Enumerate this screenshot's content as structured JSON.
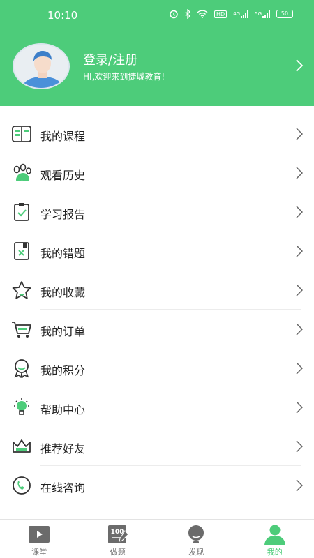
{
  "status_bar": {
    "time": "10:10",
    "network_1": "4G",
    "network_2": "5G",
    "hd": "HD",
    "battery": "50"
  },
  "colors": {
    "brand_green": "#4dcc7a",
    "tab_inactive": "#777777"
  },
  "header": {
    "login_label": "登录/注册",
    "welcome_text": "HI,欢迎来到捷城教育!"
  },
  "menu": {
    "items": [
      {
        "label": "我的课程",
        "icon": "course-book-icon"
      },
      {
        "label": "观看历史",
        "icon": "paw-history-icon"
      },
      {
        "label": "学习报告",
        "icon": "clipboard-check-icon"
      },
      {
        "label": "我的错题",
        "icon": "wrong-question-icon"
      },
      {
        "label": "我的收藏",
        "icon": "star-icon"
      },
      {
        "label": "我的订单",
        "icon": "cart-icon"
      },
      {
        "label": "我的积分",
        "icon": "badge-award-icon"
      },
      {
        "label": "帮助中心",
        "icon": "lightbulb-icon"
      },
      {
        "label": "推荐好友",
        "icon": "crown-icon"
      },
      {
        "label": "在线咨询",
        "icon": "phone-icon"
      }
    ]
  },
  "tabbar": {
    "tabs": [
      {
        "label": "课堂",
        "icon": "video-play-icon",
        "active": false
      },
      {
        "label": "做题",
        "icon": "score-100-icon",
        "active": false
      },
      {
        "label": "发现",
        "icon": "discover-bulb-icon",
        "active": false
      },
      {
        "label": "我的",
        "icon": "user-profile-icon",
        "active": true
      }
    ]
  }
}
